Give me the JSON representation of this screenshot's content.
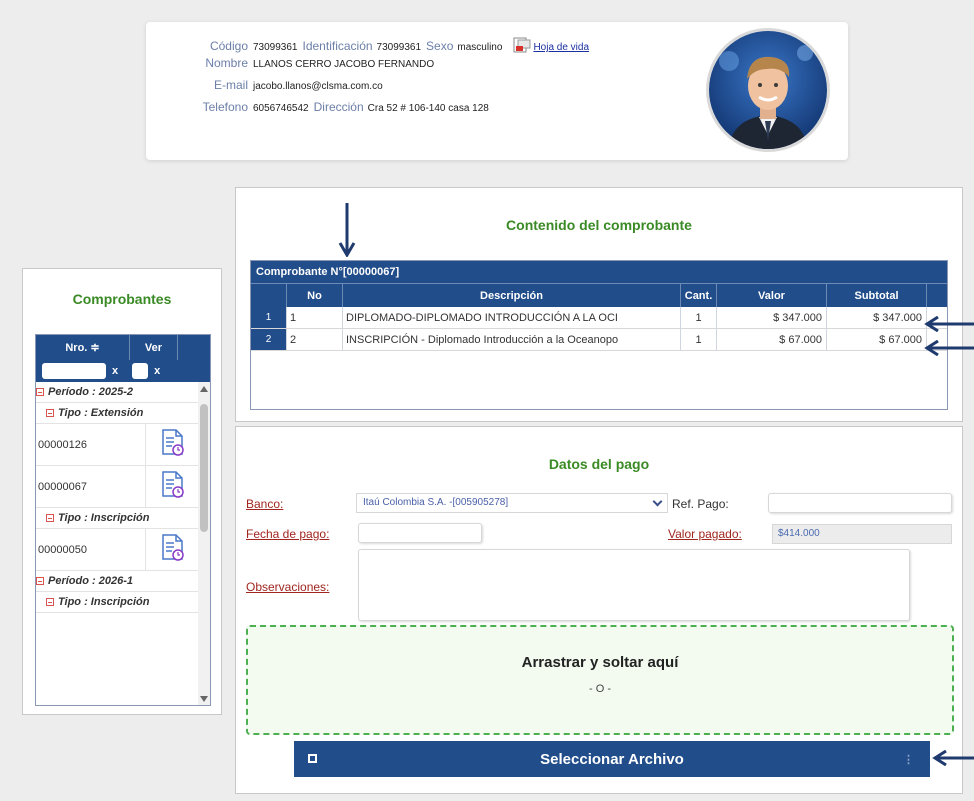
{
  "profile": {
    "codigo_label": "Código",
    "codigo": "73099361",
    "identificacion_label": "Identificación",
    "identificacion": "73099361",
    "sexo_label": "Sexo",
    "sexo": "masculino",
    "hoja_vida": "Hoja de vida",
    "nombre_label": "Nombre",
    "nombre": "LLANOS CERRO JACOBO FERNANDO",
    "email_label": "E-mail",
    "email": "jacobo.llanos@clsma.com.co",
    "telefono_label": "Telefono",
    "telefono": "6056746542",
    "direccion_label": "Dirección",
    "direccion": "Cra 52 # 106-140 casa 128"
  },
  "comprobantes": {
    "title": "Comprobantes",
    "col_nro": "Nro. ≑",
    "col_ver": "Ver",
    "filter_clear": "x",
    "groups": {
      "periodo1": "Período : 2025-2",
      "tipo1": "Tipo : Extensión",
      "row1": "00000126",
      "row2": "00000067",
      "tipo2": "Tipo : Inscripción",
      "row3": "00000050",
      "periodo2": "Período : 2026-1",
      "tipo3": "Tipo : Inscripción"
    }
  },
  "contenido": {
    "title": "Contenido del comprobante",
    "caption": "Comprobante N°[00000067]",
    "headers": {
      "no": "No",
      "descripcion": "Descripción",
      "cant": "Cant.",
      "valor": "Valor",
      "subtotal": "Subtotal"
    },
    "rows": [
      {
        "rn": "1",
        "no": "1",
        "descripcion": "DIPLOMADO-DIPLOMADO INTRODUCCIÓN A LA OCI",
        "cant": "1",
        "valor": "$ 347.000",
        "subtotal": "$ 347.000"
      },
      {
        "rn": "2",
        "no": "2",
        "descripcion": "INSCRIPCIÓN - Diplomado Introducción a la Oceanopo",
        "cant": "1",
        "valor": "$ 67.000",
        "subtotal": "$ 67.000"
      }
    ]
  },
  "pago": {
    "title": "Datos del pago",
    "banco_label": "Banco:",
    "banco_value": "Itaú Colombia S.A. -[005905278]",
    "ref_label": "Ref. Pago:",
    "ref_value": "",
    "fecha_label": "Fecha de pago:",
    "fecha_value": "",
    "valor_label": "Valor pagado:",
    "valor_value": "$414.000",
    "obs_label": "Observaciones:",
    "drop_title": "Arrastrar y soltar aquí",
    "drop_or": "- O -",
    "select_button": "Seleccionar Archivo"
  },
  "colors": {
    "header_blue": "#214d8a",
    "title_green": "#3a8a25",
    "label_red": "#a0251f",
    "annotation_arrow": "#1f3a6e"
  },
  "icons": [
    "pdf-icon",
    "document-clock-icon",
    "file-icon",
    "arrow-annotation"
  ]
}
